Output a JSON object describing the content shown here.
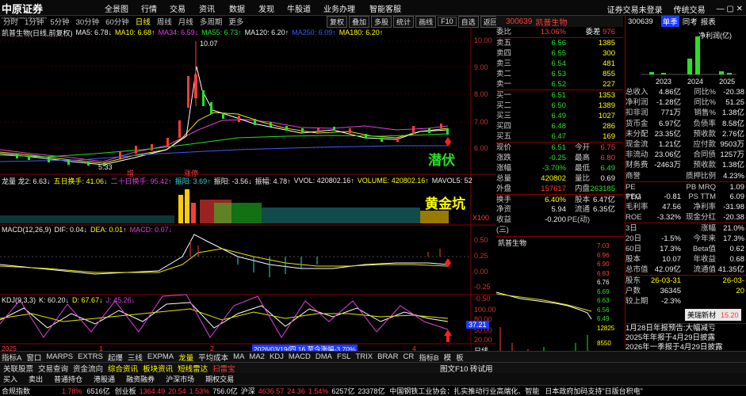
{
  "app": {
    "logo_cn": "中原证券",
    "logo_en": "CENTRAL CHINA SECURITIES"
  },
  "menu": [
    "全景图",
    "行情",
    "交易",
    "资讯",
    "数据",
    "发现",
    "牛股道",
    "业务办理",
    "智能客服"
  ],
  "menu_right": [
    "证券交易未登录",
    "传统交易"
  ],
  "toolbar": {
    "items": [
      "分时",
      "1分钟",
      "5分钟",
      "30分钟",
      "60分钟",
      "日线",
      "周线",
      "月线",
      "多周期",
      "更多"
    ],
    "active": "日线"
  },
  "toolbar2": [
    "复权",
    "叠加",
    "多股",
    "统计",
    "画线",
    "F10",
    "自选",
    "返回"
  ],
  "chart_head": {
    "title": "凯普生物(日线,前复权)",
    "ma5": "MA5: 6.78↓",
    "ma10": "MA10: 6.68↑",
    "ma34": "MA34: 6.59↓",
    "ma55": "MA55: 6.73↑",
    "ma120": "MA120: 6.20↑",
    "ma250": "MA250: 6.09↑",
    "ma180": "MA180: 6.20↑"
  },
  "price_axis": [
    "10.00",
    "9.00",
    "8.00",
    "7.00",
    "6.00"
  ],
  "annotations": {
    "high": "10.07",
    "low": "5.33",
    "qianfu": "潜伏",
    "huangjinkeng": "黄金坑",
    "x100": "X100",
    "zeng": "增",
    "zhangting": "涨停"
  },
  "vol_head": {
    "name": "龙量 龙2: 6.63↓",
    "a": "五日换手: 41.06↓",
    "b": "二十日换手: 95.42↑",
    "c": "振阳: 3.69↑",
    "d": "振阳: -3.56↓",
    "e": "振幅: 4.78↑",
    "f": "VVOL: 420802.16↑",
    "g": "VOLUME: 420802.16↑",
    "h": "MAVOL5: 52"
  },
  "macd_head": {
    "name": "MACD(12,26,9)",
    "dif": "DIF: 0.04↓",
    "dea": "DEA: 0.01↑",
    "macd": "MACD: 0.07↓"
  },
  "macd_axis": [
    "0.50",
    "0.25",
    "0.00",
    "-0.25",
    "-0.50"
  ],
  "kdj_head": {
    "name": "KDJ(9,3,3)",
    "k": "K: 60.20↓",
    "d": "D: 67.67↓",
    "j": "J: 45.26↓"
  },
  "kdj_axis": [
    "100.00",
    "80.00",
    "50.00",
    "20.00"
  ],
  "date_bar": {
    "y": "2025",
    "m1": "1",
    "m2": "2",
    "m3": "3",
    "m4": "4",
    "current": "2026/03/19/四 16 至今涨幅-3.70%",
    "cur_val": "37.21",
    "period": "日线"
  },
  "tabs": [
    "指标A",
    "窗口",
    "MARPS",
    "EXTRS",
    "起爆",
    "三线",
    "EXPMA",
    "龙量",
    "平均成本",
    "MA",
    "MA2",
    "KDJ",
    "MACD",
    "DMA",
    "FSL",
    "TRIX",
    "BRAR",
    "CR",
    "指标B",
    "模",
    "板"
  ],
  "tabs2": [
    "关联股票",
    "交易查询",
    "资金流向",
    "综合资讯",
    "板块资讯",
    "短线雷达",
    "扫雷宝"
  ],
  "tabs2_right": "图文F10 砖试用",
  "quote": {
    "code": "300639",
    "name": "凯普生物",
    "weibi_l": "委比",
    "weibi": "13.06%",
    "weicha_l": "委差",
    "weicha": "976",
    "asks": [
      {
        "l": "卖五",
        "p": "6.56",
        "v": "1385"
      },
      {
        "l": "卖四",
        "p": "6.55",
        "v": "300"
      },
      {
        "l": "卖三",
        "p": "6.54",
        "v": "481"
      },
      {
        "l": "卖二",
        "p": "6.53",
        "v": "855"
      },
      {
        "l": "卖一",
        "p": "6.52",
        "v": "227"
      }
    ],
    "bids": [
      {
        "l": "买一",
        "p": "6.51",
        "v": "1353"
      },
      {
        "l": "买二",
        "p": "6.50",
        "v": "1389"
      },
      {
        "l": "买三",
        "p": "6.49",
        "v": "1027"
      },
      {
        "l": "买四",
        "p": "6.48",
        "v": "286"
      },
      {
        "l": "买五",
        "p": "6.47",
        "v": "169"
      }
    ],
    "stats": [
      [
        "现价",
        "6.51",
        "今开",
        "6.75"
      ],
      [
        "涨跌",
        "-0.25",
        "最高",
        "6.80"
      ],
      [
        "涨幅",
        "-3.70%",
        "最低",
        "6.49"
      ],
      [
        "总量",
        "420802",
        "量比",
        "0.69"
      ],
      [
        "外盘",
        "157617",
        "内盘",
        "263185"
      ],
      [
        "换手",
        "6.40%",
        "股本",
        "6.47亿"
      ],
      [
        "净资",
        "5.94",
        "流通",
        "6.35亿"
      ],
      [
        "收益(三)",
        "-0.200",
        "PE(动)",
        ""
      ]
    ]
  },
  "mini_chart": {
    "title": "凯普生物",
    "axis": [
      "7.03",
      "6.96",
      "6.90",
      "6.83",
      "6.76",
      "6.69",
      "6.63",
      "6.56",
      "6.49",
      "12825",
      "8550",
      "4275"
    ]
  },
  "mini_tabs": [
    "笔",
    "价",
    "细",
    "势",
    "联",
    "值",
    "主",
    "筹"
  ],
  "f10": {
    "code": "300639",
    "tabs": [
      "单季",
      "同考",
      "报表"
    ],
    "chart_title": "净利润(亿)",
    "years": [
      "2023",
      "2024",
      "2025"
    ],
    "rows": [
      [
        "总收入",
        "4.86亿",
        "同比%",
        "-20.38"
      ],
      [
        "净利润",
        "-1.28亿",
        "同比%",
        "51.25"
      ],
      [
        "扣非润",
        "771万",
        "销售%",
        "1.38亿"
      ],
      [
        "货币金",
        "6.97亿",
        "负债率",
        "8.58亿"
      ],
      [
        "未分配",
        "23.35亿",
        "预收款",
        "2.76亿"
      ],
      [
        "现金流",
        "1.21亿",
        "应付款",
        "9503万"
      ],
      [
        "非流动",
        "23.06亿",
        "合同债",
        "1257万"
      ],
      [
        "财务费",
        "-2463万",
        "预收款",
        "1.38亿"
      ],
      [
        "商誉",
        "",
        "质押比例",
        "4.23%"
      ],
      [
        "PE TTM",
        "",
        "PB MRQ",
        "1.09"
      ],
      [
        "PEG",
        "-0.81",
        "PS TTM",
        "6.09"
      ],
      [
        "毛利率",
        "47.56",
        "净利率",
        "-31.98"
      ],
      [
        "ROE",
        "-3.32%",
        "现金分红",
        "-20.38"
      ],
      [
        "3日",
        "",
        "涨幅",
        "21.0%"
      ],
      [
        "20日",
        "-1.5%",
        "今年来",
        "17.3%"
      ],
      [
        "60日",
        "17.3%",
        "Beta值",
        "0.62"
      ],
      [
        "股本",
        "10.07",
        "年收益",
        "0.68"
      ],
      [
        "总市值",
        "42.09亿",
        "流通值",
        "41.35亿"
      ],
      [
        "股东",
        "26-03-31",
        "",
        "26-03-20"
      ],
      [
        "户数",
        "36345",
        "",
        " "
      ],
      [
        "较上期",
        "-2.3%",
        "",
        ""
      ]
    ],
    "badge": "美瑞新材",
    "badge_val": "15.20",
    "news": [
      "1月28日年报预告:大幅减亏",
      "2025年年报于4月29日披露",
      "2026年一季报于4月29日披露"
    ]
  },
  "status": {
    "left": "合规指数",
    "s1": "1.78%",
    "v1": "6516亿",
    "label2": "创业板",
    "idx2": "1364.49",
    "chg2": "20.54",
    "p2": "1.53%",
    "v2": "756.0亿",
    "label3": "沪深",
    "idx3": "4636.57",
    "chg3": "24.36",
    "p3": "1.54%",
    "v3": "6257亿",
    "idx4": "23378亿",
    "news": "中国钢铁工业协会：扎实推动行业高端化、智能化、绿色化发展",
    "news2": "日本政府加码支持\"日版台积电\""
  }
}
